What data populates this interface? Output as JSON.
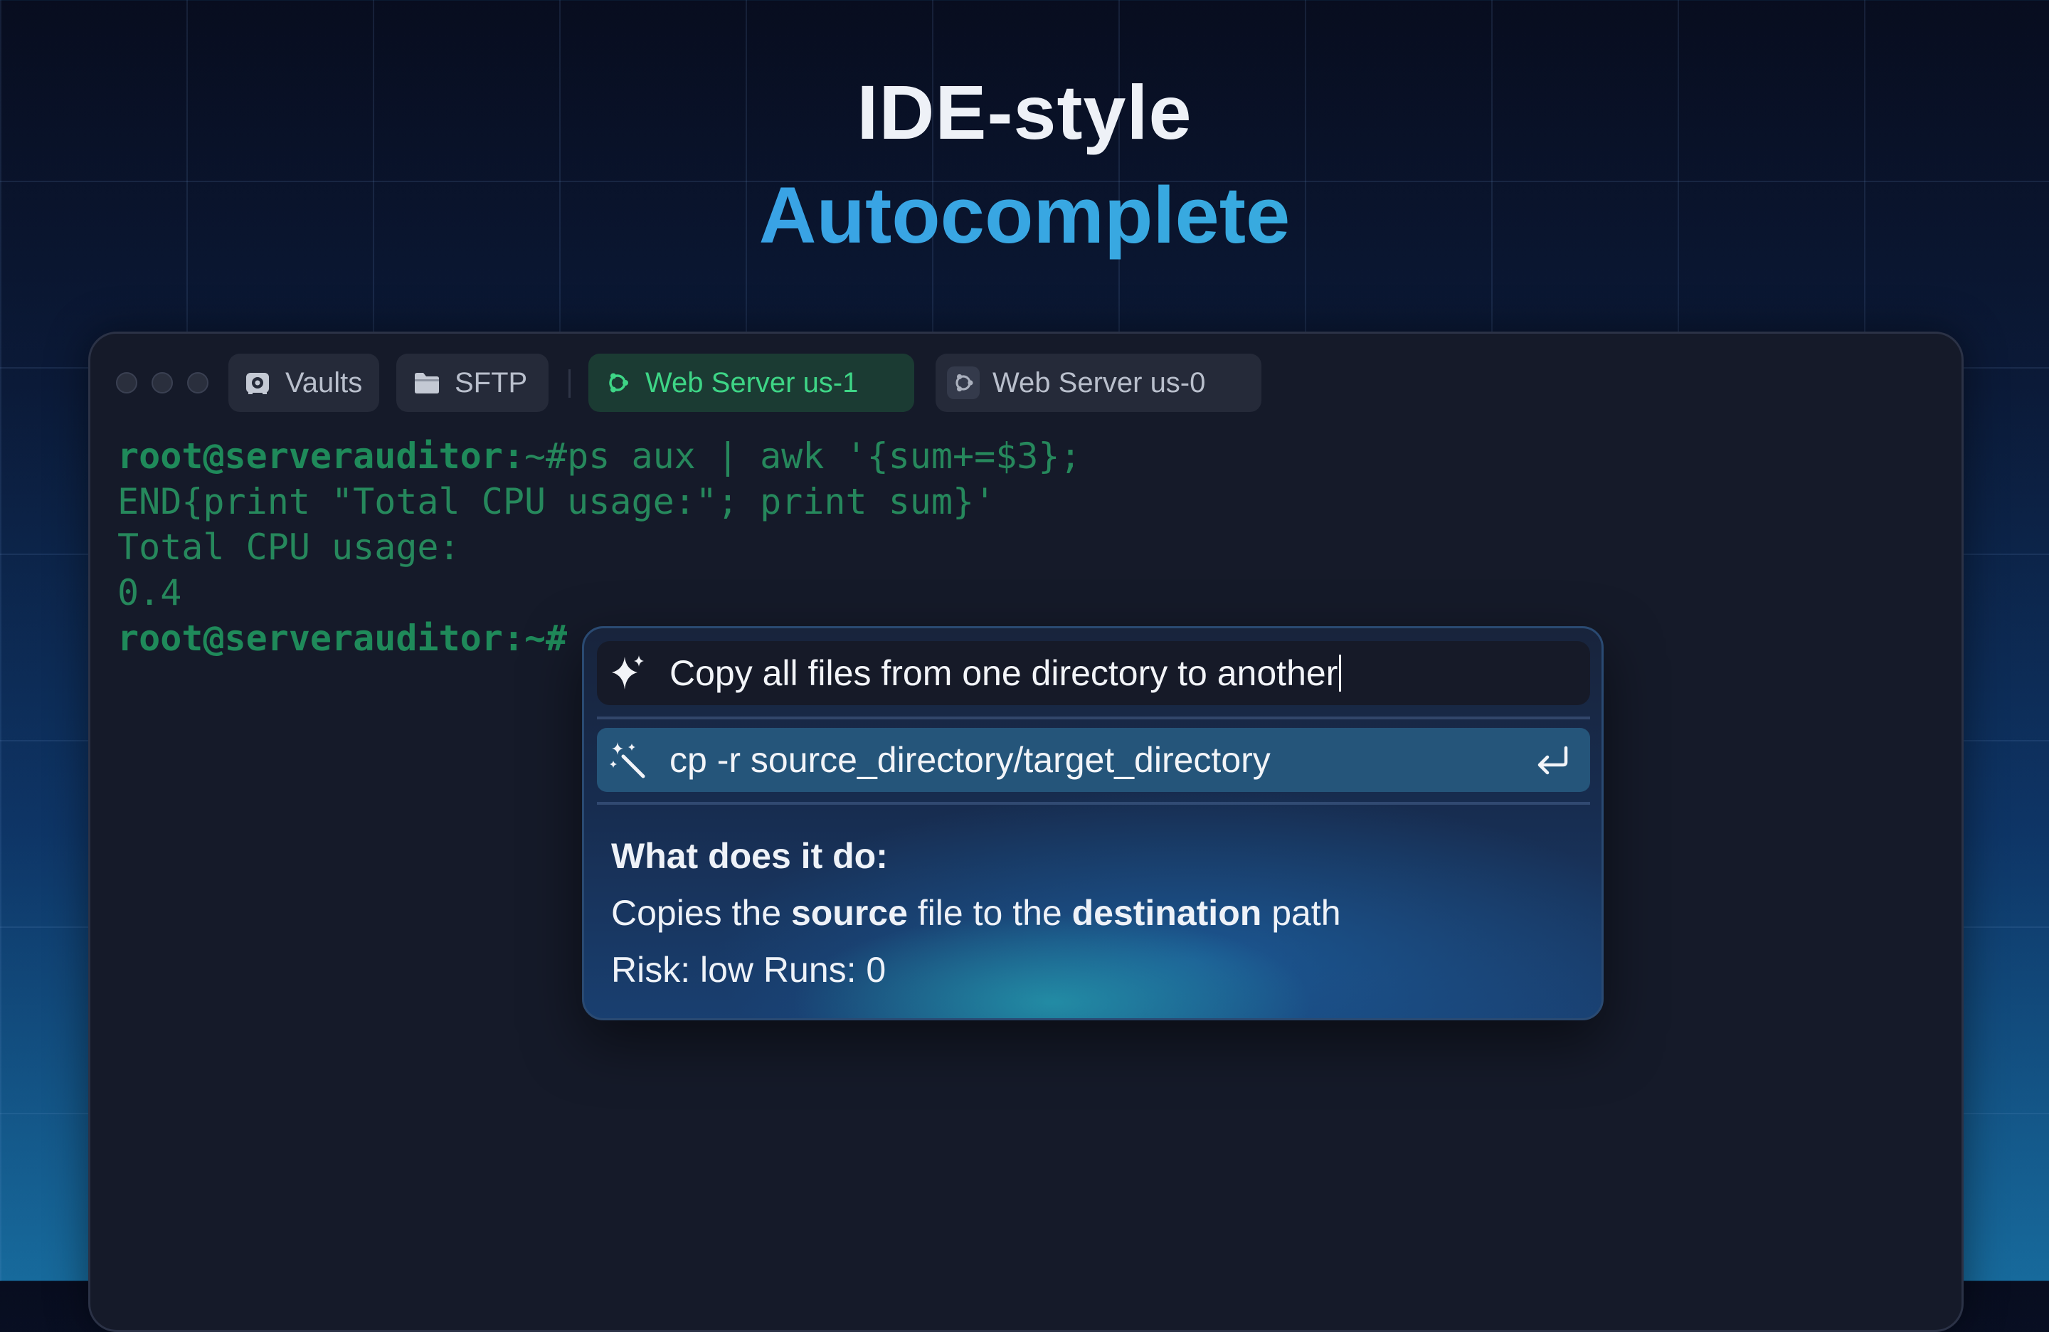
{
  "headline": {
    "line1": "IDE-style",
    "line2": "Autocomplete"
  },
  "tabs": [
    {
      "label": "Vaults",
      "icon": "vault-icon",
      "active": false
    },
    {
      "label": "SFTP",
      "icon": "folder-icon",
      "active": false
    },
    {
      "label": "Web Server us-1",
      "icon": "ubuntu-icon",
      "active": true
    },
    {
      "label": "Web Server us-0",
      "icon": "ubuntu-icon",
      "active": false
    }
  ],
  "terminal": {
    "line1_prompt": "root@serverauditor:",
    "line1_cmd": "~#ps aux | awk '{sum+=$3};",
    "line2": "END{print \"Total CPU usage:\"; print sum}'",
    "line3": "Total CPU usage:",
    "line4": "0.4",
    "line5_prompt": "root@serverauditor:",
    "line5_cmd": "~#"
  },
  "autocomplete": {
    "query": "Copy all files from one directory to another",
    "suggestion": "cp -r source_directory/target_directory",
    "description_heading": "What does it do:",
    "description_parts": [
      "Copies the ",
      "source",
      " file to the ",
      "destination",
      " path"
    ],
    "risk_line": "Risk: low Runs: 0"
  },
  "colors": {
    "accent_green": "#3ed586",
    "terminal_green": "#26885c",
    "headline_blue": "#3a97ee",
    "suggestion_bg": "#25557a"
  }
}
